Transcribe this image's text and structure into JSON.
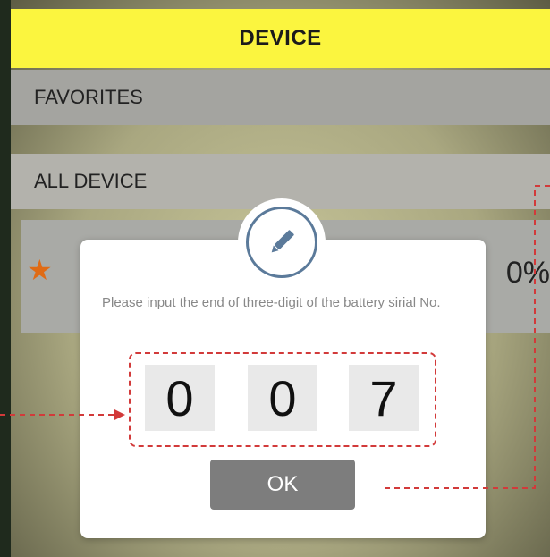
{
  "header": {
    "title": "DEVICE"
  },
  "sections": {
    "favorites_label": "FAVORITES",
    "all_device_label": "ALL DEVICE"
  },
  "device": {
    "favorite_icon": "star-icon",
    "percent_partial": "0%"
  },
  "dialog": {
    "icon": "pencil-edit-icon",
    "prompt": "Please input the end of three-digit of the battery sirial No.",
    "digits": [
      "0",
      "0",
      "7"
    ],
    "ok_label": "OK"
  },
  "colors": {
    "header_bg": "#fbf53f",
    "favorite_star": "#e06b15",
    "annotation_dash": "#d23a3a",
    "ok_button": "#7d7d7d"
  }
}
